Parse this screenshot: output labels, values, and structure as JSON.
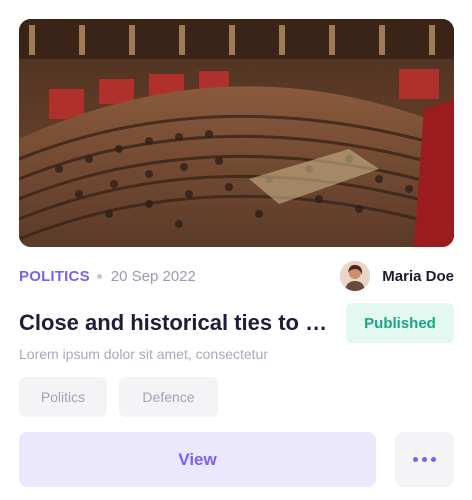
{
  "article": {
    "image_alt": "Parliament chamber",
    "category": "POLITICS",
    "date": "20 Sep 2022",
    "author_name": "Maria Doe",
    "title": "Close and historical ties to h...",
    "status": "Published",
    "excerpt": "Lorem ipsum dolor sit amet, consectetur",
    "tags": [
      "Politics",
      "Defence"
    ],
    "view_label": "View",
    "more_icon": "more-horizontal-icon"
  },
  "colors": {
    "accent": "#7b61f2",
    "status_text": "#1aa783",
    "status_bg": "#e3f8f1",
    "title": "#1f1d3a"
  }
}
